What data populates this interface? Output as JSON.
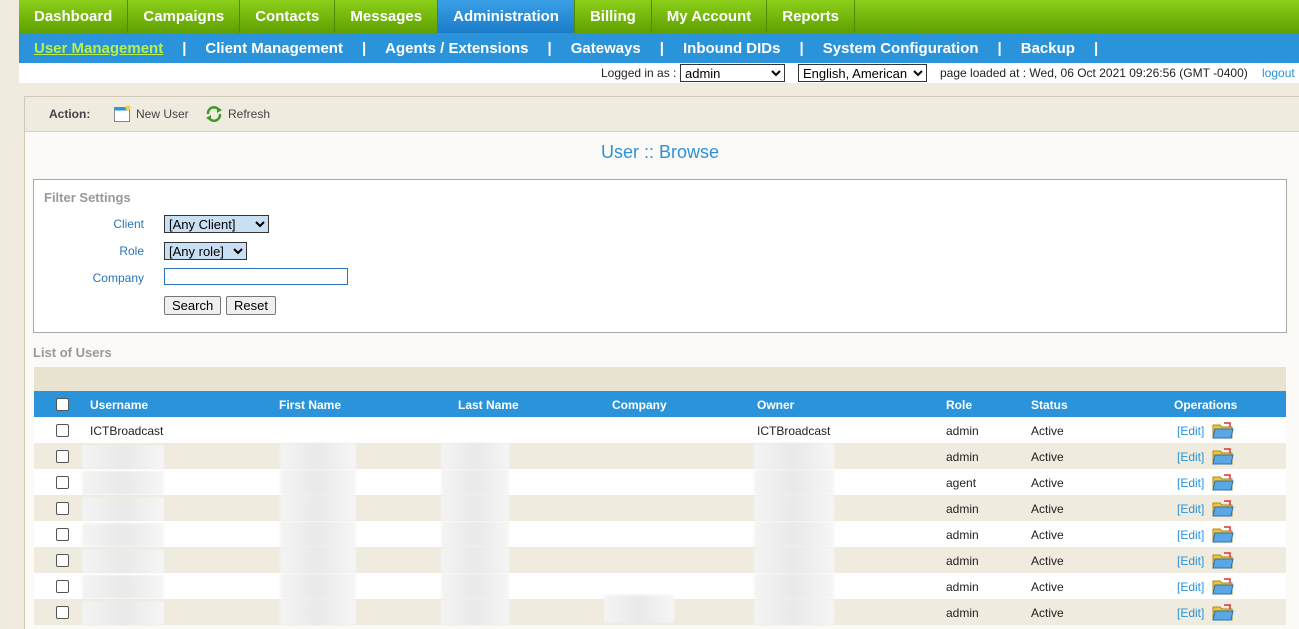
{
  "topnav": [
    "Dashboard",
    "Campaigns",
    "Contacts",
    "Messages",
    "Administration",
    "Billing",
    "My Account",
    "Reports"
  ],
  "topnav_active": 4,
  "subnav": [
    "User Management",
    "Client Management",
    "Agents / Extensions",
    "Gateways",
    "Inbound DIDs",
    "System Configuration",
    "Backup"
  ],
  "sep": "|",
  "status": {
    "logged_label": "Logged in as :",
    "user": "admin",
    "language": "English, American",
    "loaded": "page loaded at : Wed, 06 Oct 2021 09:26:56 (GMT -0400)",
    "logout": "logout"
  },
  "actions": {
    "label": "Action:",
    "new_user": "New User",
    "refresh": "Refresh"
  },
  "title": "User :: Browse",
  "filter": {
    "title": "Filter Settings",
    "client_label": "Client",
    "client_value": "[Any Client]",
    "role_label": "Role",
    "role_value": "[Any role]",
    "company_label": "Company",
    "search": "Search",
    "reset": "Reset"
  },
  "list_title": "List of Users",
  "columns": [
    "Username",
    "First Name",
    "Last Name",
    "Company",
    "Owner",
    "Role",
    "Status",
    "Operations"
  ],
  "rows": [
    {
      "username": "ICTBroadcast",
      "owner": "ICTBroadcast",
      "role": "admin",
      "status": "Active"
    },
    {
      "username": "",
      "owner": "",
      "role": "admin",
      "status": "Active"
    },
    {
      "username": "",
      "owner": "",
      "role": "agent",
      "status": "Active"
    },
    {
      "username": "",
      "owner": "",
      "role": "admin",
      "status": "Active"
    },
    {
      "username": "",
      "owner": "",
      "role": "admin",
      "status": "Active"
    },
    {
      "username": "",
      "owner": "",
      "role": "admin",
      "status": "Active"
    },
    {
      "username": "",
      "owner": "",
      "role": "admin",
      "status": "Active"
    },
    {
      "username": "",
      "owner": "",
      "role": "admin",
      "status": "Active"
    }
  ],
  "edit_label": "[Edit]",
  "colors": {
    "green": "#6cb40a",
    "blue": "#2b93d9",
    "active_sub": "#b8f04a"
  }
}
